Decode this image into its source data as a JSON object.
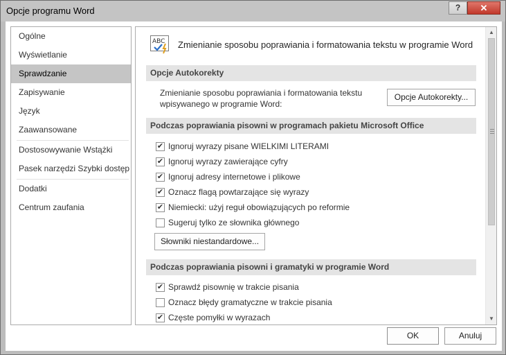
{
  "window": {
    "title": "Opcje programu Word",
    "help_label": "?",
    "close_label": "✕"
  },
  "nav": {
    "items": [
      {
        "label": "Ogólne"
      },
      {
        "label": "Wyświetlanie"
      },
      {
        "label": "Sprawdzanie",
        "selected": true
      },
      {
        "label": "Zapisywanie"
      },
      {
        "label": "Język"
      },
      {
        "label": "Zaawansowane"
      },
      {
        "label": "Dostosowywanie Wstążki"
      },
      {
        "label": "Pasek narzędzi Szybki dostęp"
      },
      {
        "label": "Dodatki"
      },
      {
        "label": "Centrum zaufania"
      }
    ]
  },
  "content": {
    "header_icon": "abc-check-icon",
    "header_title": "Zmienianie sposobu poprawiania i formatowania tekstu w programie Word",
    "autocorrect": {
      "section_title": "Opcje Autokorekty",
      "description_line1": "Zmienianie sposobu poprawiania i formatowania tekstu",
      "description_line2": "wpisywanego w programie Word:",
      "button_label": "Opcje Autokorekty..."
    },
    "office_spelling": {
      "section_title": "Podczas poprawiania pisowni w programach pakietu Microsoft Office",
      "options": [
        {
          "label": "Ignoruj wyrazy pisane WIELKIMI LITERAMI",
          "checked": true
        },
        {
          "label": "Ignoruj wyrazy zawierające cyfry",
          "checked": true
        },
        {
          "label": "Ignoruj adresy internetowe i plikowe",
          "checked": true
        },
        {
          "label": "Oznacz flagą powtarzające się wyrazy",
          "checked": true
        },
        {
          "label": "Niemiecki: użyj reguł obowiązujących po reformie",
          "checked": true
        },
        {
          "label": "Sugeruj tylko ze słownika głównego",
          "checked": false
        }
      ],
      "dictionaries_button": "Słowniki niestandardowe..."
    },
    "word_spelling": {
      "section_title": "Podczas poprawiania pisowni i gramatyki w programie Word",
      "options": [
        {
          "label": "Sprawdź pisownię w trakcie pisania",
          "checked": true
        },
        {
          "label": "Oznacz błędy gramatyczne w trakcie pisania",
          "checked": false
        },
        {
          "label": "Częste pomyłki w wyrazach",
          "checked": true
        }
      ]
    }
  },
  "footer": {
    "ok_label": "OK",
    "cancel_label": "Anuluj"
  },
  "colors": {
    "selected_nav_bg": "#c5c5c5",
    "section_bg": "#e4e4e4",
    "close_button": "#c1392b"
  }
}
